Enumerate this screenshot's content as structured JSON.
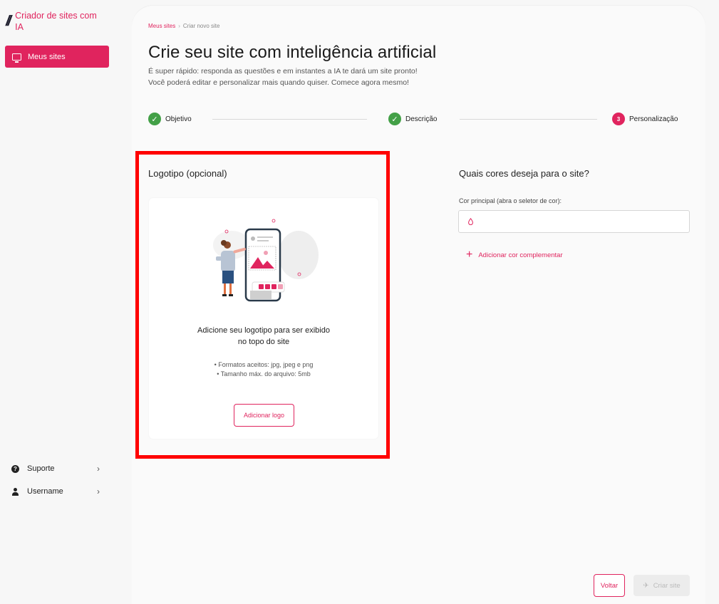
{
  "sidebar": {
    "brand_mark": "//",
    "brand_name": "Criador de sites com IA",
    "active_item": {
      "label": "Meus sites",
      "icon": "monitor-icon"
    },
    "bottom_items": [
      {
        "label": "Suporte",
        "icon": "help-icon",
        "icon_glyph": "?"
      },
      {
        "label": "Username",
        "icon": "user-icon"
      }
    ]
  },
  "breadcrumb": {
    "parent": "Meus sites",
    "current": "Criar novo site"
  },
  "header": {
    "title": "Crie seu site com inteligência artificial",
    "subtitle_line1": "É super rápido: responda as questões e em instantes a IA te dará um site pronto!",
    "subtitle_line2": "Você poderá editar e personalizar mais quando quiser. Comece agora mesmo!"
  },
  "stepper": {
    "steps": [
      {
        "label": "Objetivo",
        "state": "done"
      },
      {
        "label": "Descrição",
        "state": "done"
      },
      {
        "label": "Personalização",
        "state": "active",
        "number": "3"
      }
    ]
  },
  "logo_section": {
    "title": "Logotipo (opcional)",
    "headline_line1": "Adicione seu logotipo para ser exibido",
    "headline_line2": "no topo do site",
    "req1": "• Formatos aceitos: jpg, jpeg e png",
    "req2": "• Tamanho máx. do arquivo: 5mb",
    "button": "Adicionar logo"
  },
  "colors_section": {
    "title": "Quais cores deseja para o site?",
    "primary_label": "Cor principal (abra o seletor de cor):",
    "primary_value": "",
    "add_button": "Adicionar cor complementar"
  },
  "footer": {
    "back": "Voltar",
    "create": "Criar site"
  },
  "colors": {
    "accent": "#e0245e",
    "success": "#43a047",
    "highlight": "#ff0000"
  }
}
